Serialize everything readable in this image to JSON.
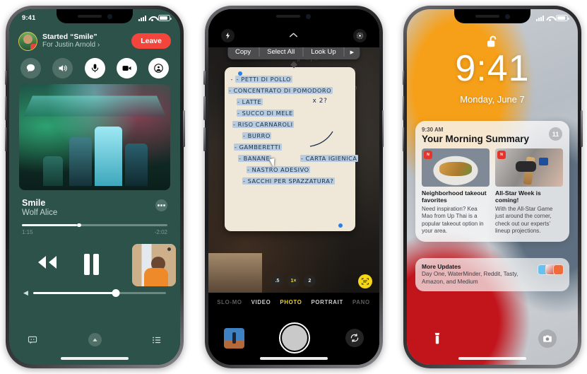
{
  "phone1": {
    "name": "shareplay-music-player",
    "status_bar": {
      "time": "9:41"
    },
    "shareplay": {
      "title": "Started “Smile”",
      "subtitle": "For Justin Arnold ›",
      "leave_label": "Leave"
    },
    "controls": [
      {
        "name": "messages-bubble-icon",
        "icon": "chat"
      },
      {
        "name": "speaker-icon",
        "icon": "speaker"
      },
      {
        "name": "microphone-icon",
        "icon": "mic",
        "active": true
      },
      {
        "name": "video-camera-icon",
        "icon": "video",
        "active": true
      },
      {
        "name": "shareplay-icon",
        "icon": "shareplay",
        "active": true
      }
    ],
    "now_playing": {
      "song": "Smile",
      "artist": "Wolf Alice",
      "elapsed": "1:15",
      "remaining": "-2:02",
      "more_label": "•••"
    },
    "tabs": [
      {
        "name": "lyrics-icon"
      },
      {
        "name": "airplay-icon"
      },
      {
        "name": "queue-list-icon"
      }
    ]
  },
  "phone2": {
    "name": "camera-live-text",
    "top_controls": [
      {
        "name": "flash-icon"
      },
      {
        "name": "chevron-up-icon"
      },
      {
        "name": "live-photo-icon"
      }
    ],
    "popover": {
      "items": [
        "Copy",
        "Select All",
        "Look Up"
      ],
      "more_arrow": "▶"
    },
    "note_lines": [
      "- PETTI DI POLLO",
      "- CONCENTRATO DI POMODORO",
      "- LATTE",
      "- SUCCO DI MELE",
      "- RISO CARNAROLI",
      "- BURRO",
      "- GAMBERETTI",
      "- BANANE",
      "- CARTA IGIENICA",
      "- NASTRO ADESIVO",
      "- SACCHI PER SPAZZATURA?"
    ],
    "note_annotation": "x 2?",
    "zoom_levels": [
      ".5",
      "1×",
      "2"
    ],
    "zoom_selected": "1×",
    "modes": [
      "SLO-MO",
      "VIDEO",
      "PHOTO",
      "PORTRAIT",
      "PANO"
    ],
    "mode_selected": "PHOTO",
    "bottom": {
      "thumbnail_name": "last-photo-thumbnail",
      "shutter_name": "shutter-button",
      "flip_name": "flip-camera-button"
    }
  },
  "phone3": {
    "name": "lock-screen-notification-summary",
    "time": "9:41",
    "date": "Monday, June 7",
    "summary": {
      "time": "9:30 AM",
      "title": "Your Morning Summary",
      "badge": "11",
      "items": [
        {
          "headline": "Neighborhood takeout favorites",
          "body": "Need inspiration? Kea Mao from Up Thai is a popular takeout option in your area."
        },
        {
          "headline": "All-Star Week is coming!",
          "body": "With the All-Star Game just around the corner, check out our experts’ lineup projections."
        }
      ]
    },
    "more_updates": {
      "title": "More Updates",
      "body": "Day One, WaterMinder, Reddit, Tasty, Amazon, and Medium"
    },
    "bottom": {
      "flashlight_name": "flashlight-button",
      "camera_name": "camera-button"
    }
  },
  "colors": {
    "phone1_bg": "#2d5249",
    "leave_red": "#f4453c",
    "camera_yellow": "#f5d718",
    "selection_blue": "#2b7df0",
    "highlight_blue": "#b9cbdf"
  }
}
